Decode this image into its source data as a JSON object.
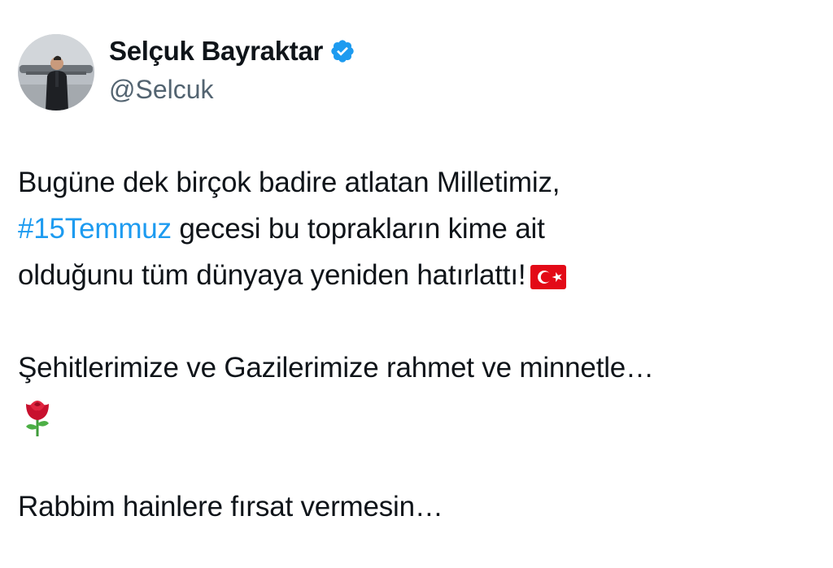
{
  "author": {
    "display_name": "Selçuk Bayraktar",
    "handle": "@Selcuk",
    "verified_icon": "verified-badge-icon",
    "badge_color": "#1d9bf0"
  },
  "tweet": {
    "line1": "Bugüne dek birçok badire atlatan Milletimiz,",
    "hashtag": "#15Temmuz",
    "line2_rest": " gecesi bu toprakların kime ait",
    "line3": "olduğunu tüm dünyaya yeniden hatırlattı!",
    "line3_emoji": "turkey-flag-icon",
    "line4": "Şehitlerimize ve Gazilerimize rahmet ve minnetle…",
    "line5_emoji": "rose-icon",
    "line6": "Rabbim hainlere fırsat vermesin…"
  },
  "colors": {
    "text": "#0f1419",
    "secondary": "#536471",
    "link": "#1d9bf0",
    "flag_red": "#e30a17"
  }
}
